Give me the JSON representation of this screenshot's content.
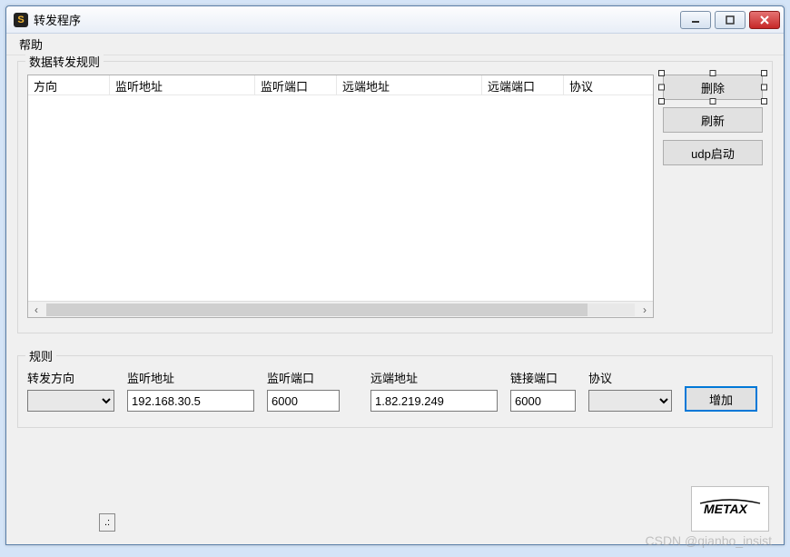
{
  "window": {
    "title": "转发程序"
  },
  "menu": {
    "help": "帮助"
  },
  "rules_group": {
    "title": "数据转发规则",
    "columns": {
      "direction": "方向",
      "listen_addr": "监听地址",
      "listen_port": "监听端口",
      "remote_addr": "远端地址",
      "remote_port": "远端端口",
      "protocol": "协议"
    },
    "buttons": {
      "delete": "删除",
      "refresh": "刷新",
      "udp_start": "udp启动"
    }
  },
  "form_group": {
    "title": "规则",
    "labels": {
      "direction": "转发方向",
      "listen_addr": "监听地址",
      "listen_port": "监听端口",
      "remote_addr": "远端地址",
      "conn_port": "链接端口",
      "protocol": "协议"
    },
    "values": {
      "direction": "",
      "listen_addr": "192.168.30.5",
      "listen_port": "6000",
      "remote_addr": "1.82.219.249",
      "conn_port": "6000",
      "protocol": ""
    },
    "add_button": "增加"
  },
  "tiny_indicator": ".:",
  "logo_text": "METAX",
  "watermark": "CSDN @qianbo_insist"
}
